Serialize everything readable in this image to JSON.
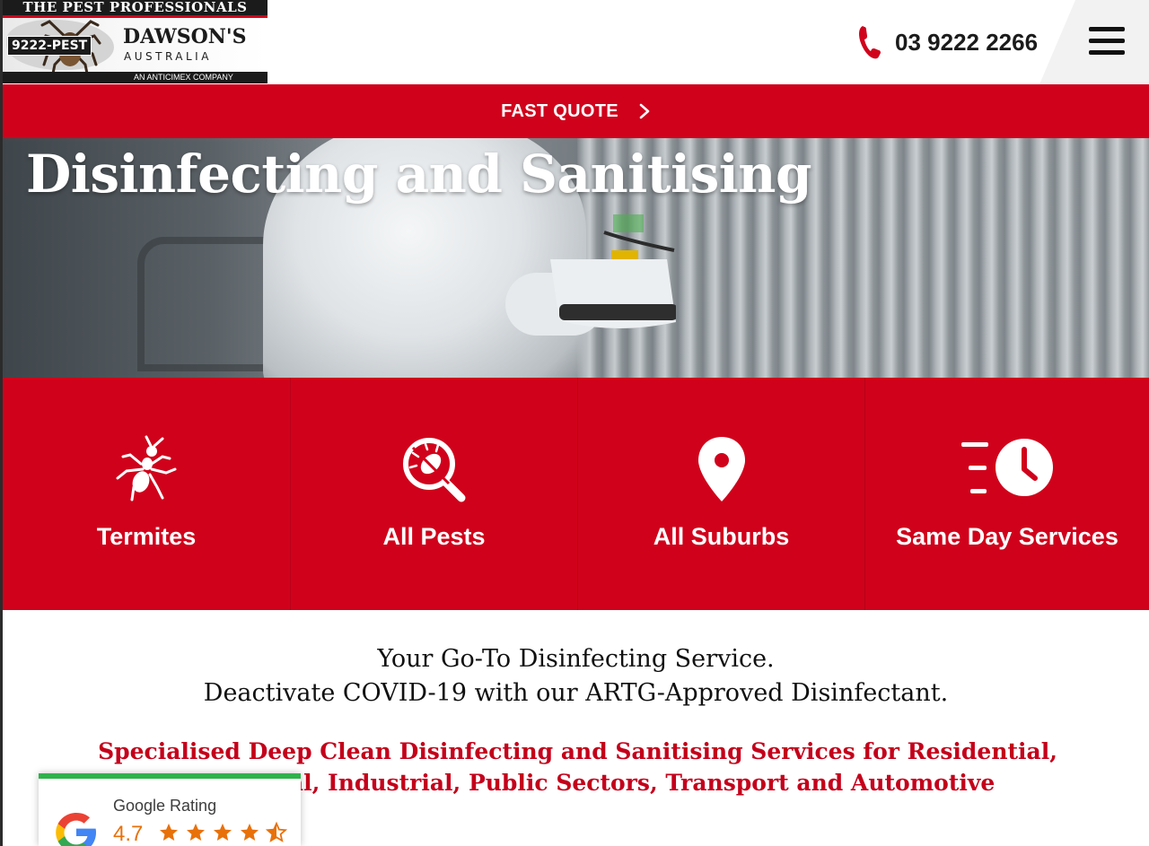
{
  "logo": {
    "tagline": "THE PEST PROFESSIONALS",
    "badge": "9222-PEST",
    "brand": "DAWSON'S",
    "country": "AUSTRALIA",
    "subline": "AN ANTICIMEX COMPANY"
  },
  "header": {
    "phone_icon": "phone-icon",
    "phone_number": "03 9222 2266",
    "menu_icon": "hamburger-menu-icon"
  },
  "quote_bar": {
    "label": "FAST QUOTE",
    "icon": "chevron-right-icon"
  },
  "hero": {
    "title": "Disinfecting and Sanitising"
  },
  "services": [
    {
      "label": "Termites",
      "icon": "ant-icon"
    },
    {
      "label": "All Pests",
      "icon": "bug-search-icon"
    },
    {
      "label": "All Suburbs",
      "icon": "location-pin-icon"
    },
    {
      "label": "Same Day Services",
      "icon": "fast-clock-icon"
    }
  ],
  "intro": {
    "line1": "Your Go-To Disinfecting Service.",
    "line2": "Deactivate COVID-19 with our ARTG-Approved Disinfectant."
  },
  "specialised": "Specialised Deep Clean Disinfecting and Sanitising Services for Residential, Commercial, Industrial, Public Sectors, Transport and Automotive",
  "google_rating": {
    "title": "Google Rating",
    "score": "4.7",
    "stars": 4.5
  },
  "colors": {
    "brand_red": "#d0021b",
    "text_red": "#c4001a",
    "star_orange": "#e8710a",
    "rating_green": "#2fb24c"
  }
}
